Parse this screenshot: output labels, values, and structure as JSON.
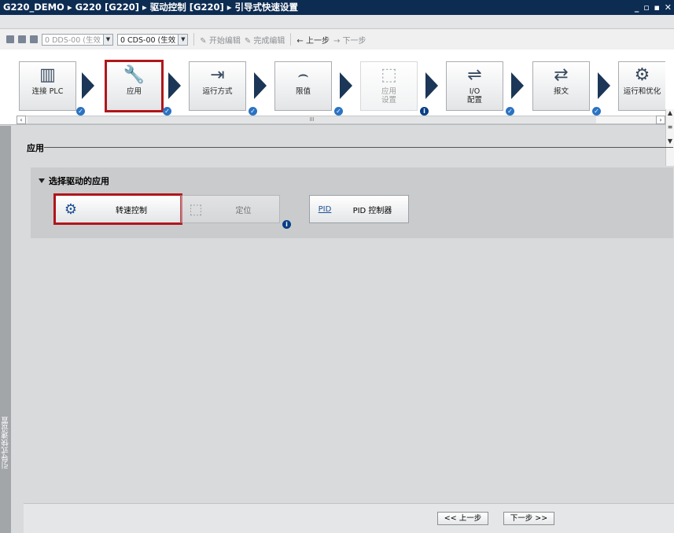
{
  "titlebar": {
    "breadcrumb": "G220_DEMO  ▸  G220 [G220]  ▸  驱动控制 [G220]  ▸  引导式快速设置",
    "controls": "_ ▫ ▪ ✕"
  },
  "toolbar": {
    "dds_select": "0 DDS-00  (生效",
    "cds_select": "0 CDS-00  (生效",
    "start_edit": "开始编辑",
    "finish_edit": "完成编辑",
    "prev_step": "← 上一步",
    "next_step": "→ 下一步"
  },
  "wizard": {
    "steps": [
      {
        "label": "连接 PLC",
        "icon": "plc-icon"
      },
      {
        "label": "应用",
        "icon": "wrench-icon"
      },
      {
        "label": "运行方式",
        "icon": "operating-mode-icon"
      },
      {
        "label": "限值",
        "icon": "limits-icon"
      },
      {
        "label": "应用\n设置",
        "icon": "application-settings-icon"
      },
      {
        "label": "I/O\n配置",
        "icon": "io-config-icon"
      },
      {
        "label": "报文",
        "icon": "telegram-icon"
      },
      {
        "label": "运行和优化",
        "icon": "motor-icon"
      }
    ],
    "hscroll_center": "III"
  },
  "side_tab": {
    "label": "引导式快速设置"
  },
  "section": {
    "title": "应用"
  },
  "panel": {
    "title": "选择驱动的应用",
    "options": [
      {
        "label": "转速控制",
        "icon": "speed-control-icon"
      },
      {
        "label": "定位",
        "icon": "positioning-icon"
      },
      {
        "label": "PID 控制器",
        "icon": "pid-icon",
        "icon_text": "PID"
      }
    ]
  },
  "footer": {
    "prev": "<< 上一步",
    "next": "下一步 >>"
  }
}
